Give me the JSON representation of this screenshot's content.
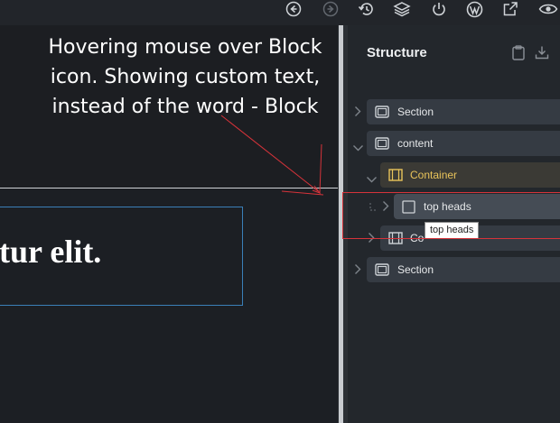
{
  "toolbar": {
    "icons": [
      "back-circle-icon",
      "forward-circle-icon",
      "history-icon",
      "layers-icon",
      "power-icon",
      "wordpress-icon",
      "external-link-icon",
      "preview-eye-icon"
    ]
  },
  "canvas": {
    "annotation": "Hovering mouse over Block icon. Showing custom text, instead of the word - Block",
    "heading": "tur elit.",
    "annotation_color": "#d6333a"
  },
  "structure": {
    "title": "Structure",
    "header_icons": [
      "clipboard-icon",
      "download-icon"
    ],
    "items": [
      {
        "label": "Section",
        "expanded": false
      },
      {
        "label": "content",
        "expanded": true
      },
      {
        "label": "Container",
        "expanded": true
      },
      {
        "label": "top heads",
        "expanded": false
      },
      {
        "label": "Co",
        "expanded": false
      },
      {
        "label": "Section",
        "expanded": false
      }
    ],
    "tooltip": "top heads",
    "accent": "#e8c35a"
  }
}
